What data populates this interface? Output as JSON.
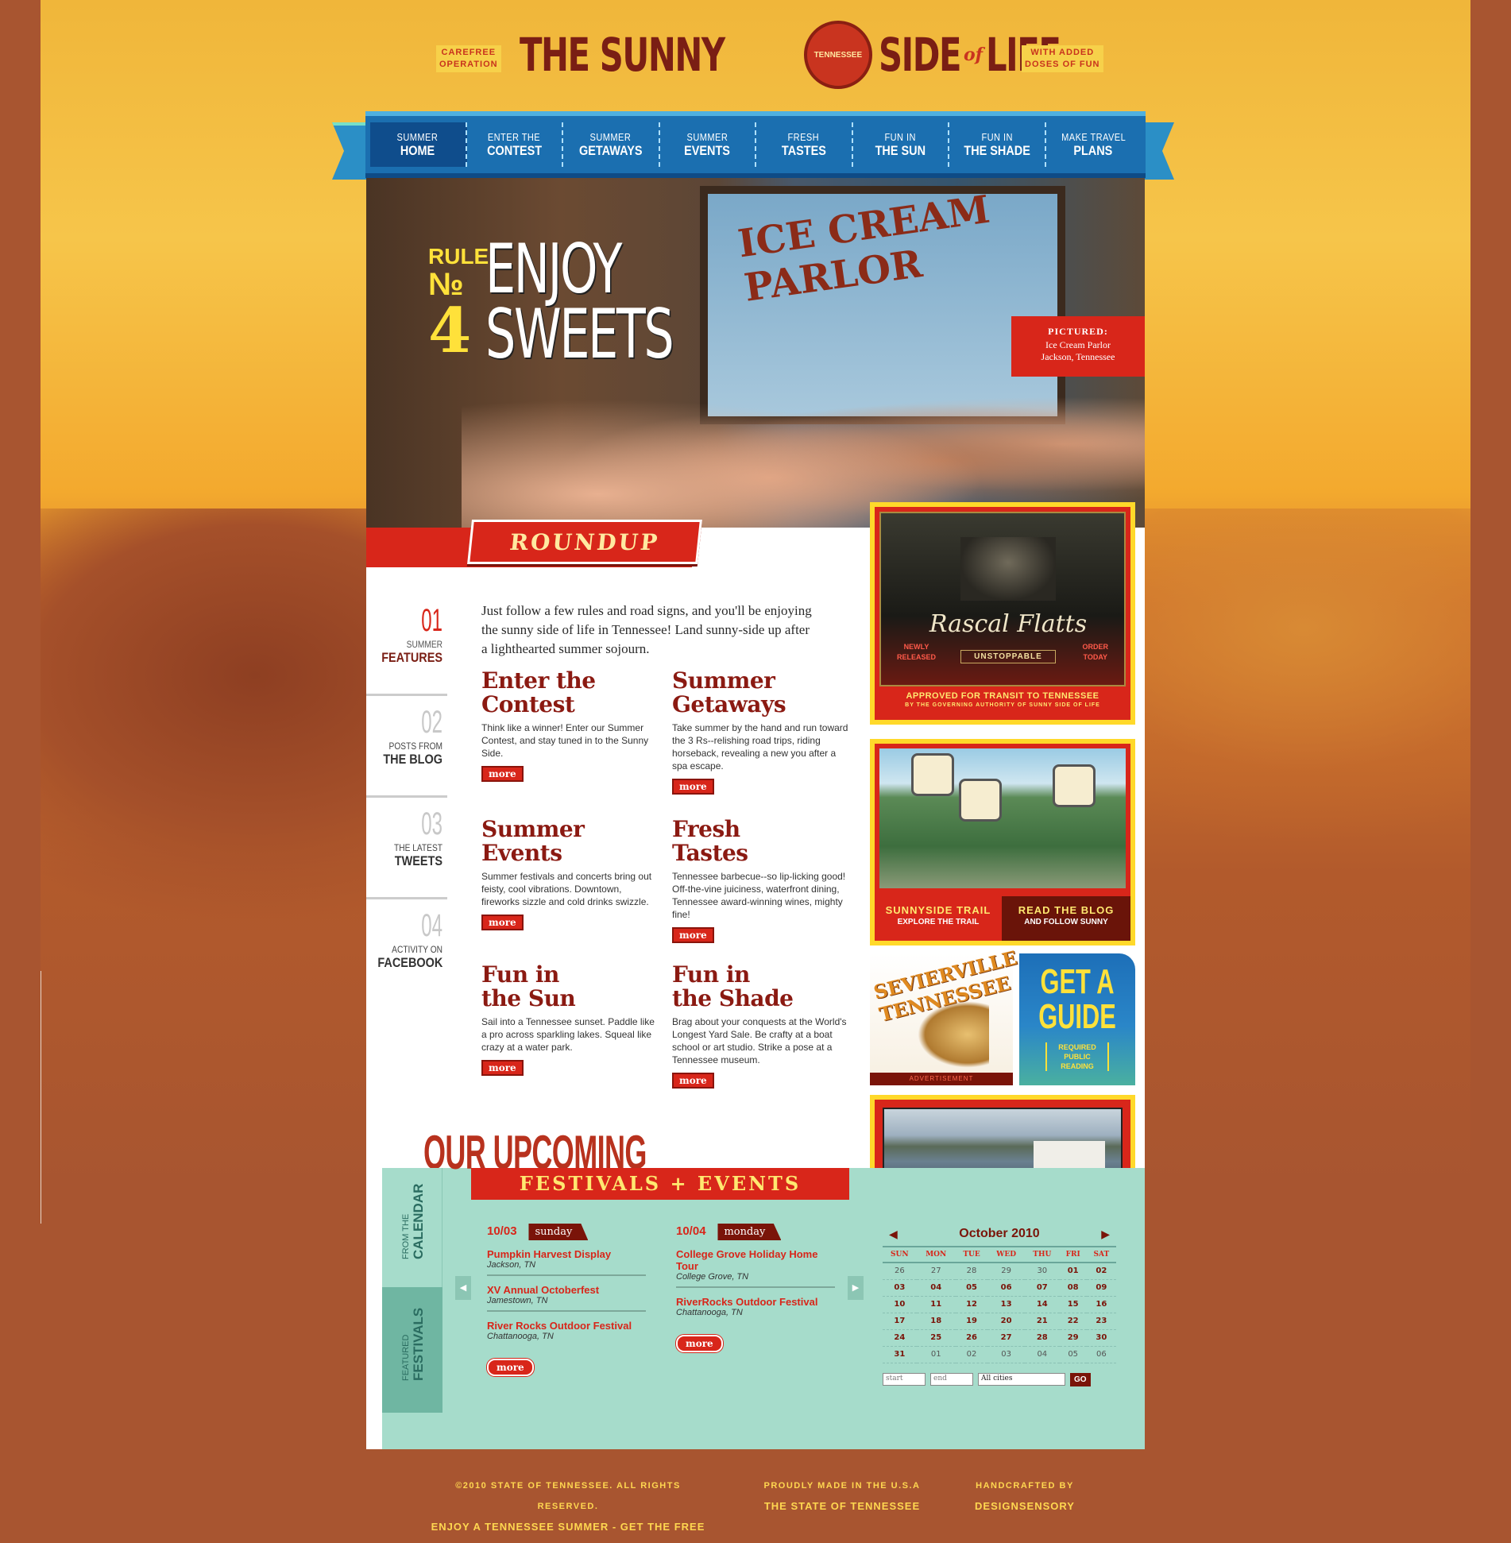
{
  "header": {
    "tag_left": [
      "CAREFREE",
      "OPERATION"
    ],
    "tag_right": [
      "WITH ADDED",
      "DOSES OF FUN"
    ],
    "logo_part1": "THE SUNNY",
    "logo_seal": "TENNESSEE",
    "logo_part2": "SIDE",
    "logo_of": "of",
    "logo_part3": "LIFE"
  },
  "nav": [
    {
      "l1": "SUMMER",
      "l2": "HOME",
      "active": true
    },
    {
      "l1": "ENTER THE",
      "l2": "CONTEST"
    },
    {
      "l1": "SUMMER",
      "l2": "GETAWAYS"
    },
    {
      "l1": "SUMMER",
      "l2": "EVENTS"
    },
    {
      "l1": "FRESH",
      "l2": "TASTES"
    },
    {
      "l1": "FUN IN",
      "l2": "THE SUN"
    },
    {
      "l1": "FUN IN",
      "l2": "THE SHADE"
    },
    {
      "l1": "MAKE TRAVEL",
      "l2": "PLANS"
    }
  ],
  "hero": {
    "rule_word": "RULE",
    "rule_no": "№",
    "rule_num": "4",
    "headline1": "ENJOY",
    "headline2": "SWEETS",
    "sign": "ICE CREAM PARLOR",
    "pictured_label": "PICTURED:",
    "pictured_line1": "Ice Cream Parlor",
    "pictured_line2": "Jackson, Tennessee"
  },
  "roundup_label": "ROUNDUP",
  "side_tabs": [
    {
      "num": "01",
      "t1": "SUMMER",
      "t2": "FEATURES",
      "active": true
    },
    {
      "num": "02",
      "t1": "POSTS FROM",
      "t2": "THE BLOG"
    },
    {
      "num": "03",
      "t1": "THE LATEST",
      "t2": "TWEETS"
    },
    {
      "num": "04",
      "t1": "ACTIVITY ON",
      "t2": "FACEBOOK"
    }
  ],
  "intro": "Just follow a few rules and road signs, and you'll be enjoying the sunny side of life in Tennessee! Land sunny-side up after a lighthearted summer sojourn.",
  "features": [
    {
      "title1": "Enter the",
      "title2": "Contest",
      "text": "Think like a winner! Enter our Summer Contest, and stay tuned in to the Sunny Side.",
      "more": "more"
    },
    {
      "title1": "Summer",
      "title2": "Getaways",
      "text": "Take summer by the hand and run toward the 3 Rs--relishing road trips, riding horseback, revealing a new you after a spa escape.",
      "more": "more"
    },
    {
      "title1": "Summer",
      "title2": "Events",
      "text": "Summer festivals and concerts bring out feisty, cool vibrations. Downtown, fireworks sizzle and cold drinks swizzle.",
      "more": "more"
    },
    {
      "title1": "Fresh",
      "title2": "Tastes",
      "text": "Tennessee barbecue--so lip-licking good! Off-the-vine juiciness, waterfront dining, Tennessee award-winning wines, mighty fine!",
      "more": "more"
    },
    {
      "title1": "Fun in",
      "title2": "the Sun",
      "text": "Sail into a Tennessee sunset. Paddle like a pro across sparkling lakes. Squeal like crazy at a water park.",
      "more": "more"
    },
    {
      "title1": "Fun in",
      "title2": "the Shade",
      "text": "Brag about your conquests at the World's Longest Yard Sale. Be crafty at a boat school or art studio. Strike a pose at a Tennessee museum.",
      "more": "more"
    }
  ],
  "promo_band": {
    "title": "Rascal Flatts",
    "subtitle": "UNSTOPPABLE",
    "left_note": [
      "NEWLY",
      "RELEASED"
    ],
    "right_note": [
      "ORDER",
      "TODAY"
    ],
    "footer": "APPROVED FOR TRANSIT TO TENNESSEE",
    "footer_small": "BY THE GOVERNING AUTHORITY OF SUNNY SIDE OF LIFE"
  },
  "promo_trail": {
    "b1_title": "SUNNYSIDE TRAIL",
    "b1_sub": "EXPLORE THE TRAIL",
    "b2_title": "READ THE BLOG",
    "b2_sub": "AND FOLLOW SUNNY"
  },
  "ad": {
    "brand": "SEVIERVILLE TENNESSEE",
    "label": "ADVERTISEMENT"
  },
  "guide": {
    "title1": "GET A",
    "title2": "GUIDE",
    "sub1": "REQUIRED",
    "sub2": "PUBLIC",
    "sub3": "READING"
  },
  "festivals": {
    "title1": "OUR UPCOMING",
    "title2": "FESTIVALS + EVENTS",
    "tab_calendar_small": "FROM THE",
    "tab_calendar_big": "CALENDAR",
    "tab_featured_small": "FEATURED",
    "tab_featured_big": "FESTIVALS",
    "days": [
      {
        "date": "10/03",
        "name": "sunday",
        "events": [
          {
            "name": "Pumpkin Harvest Display",
            "loc": "Jackson, TN"
          },
          {
            "name": "XV Annual Octoberfest",
            "loc": "Jamestown, TN"
          },
          {
            "name": "River Rocks Outdoor Festival",
            "loc": "Chattanooga, TN"
          }
        ],
        "more": "more"
      },
      {
        "date": "10/04",
        "name": "monday",
        "events": [
          {
            "name": "College Grove Holiday Home Tour",
            "loc": "College Grove, TN"
          },
          {
            "name": "RiverRocks Outdoor Festival",
            "loc": "Chattanooga, TN"
          }
        ],
        "more": "more"
      }
    ]
  },
  "calendar": {
    "month": "October 2010",
    "prev": "◀",
    "next": "▶",
    "weekdays": [
      "SUN",
      "MON",
      "TUE",
      "WED",
      "THU",
      "FRI",
      "SAT"
    ],
    "weeks": [
      [
        "26",
        "27",
        "28",
        "29",
        "30",
        "01",
        "02"
      ],
      [
        "03",
        "04",
        "05",
        "06",
        "07",
        "08",
        "09"
      ],
      [
        "10",
        "11",
        "12",
        "13",
        "14",
        "15",
        "16"
      ],
      [
        "17",
        "18",
        "19",
        "20",
        "21",
        "22",
        "23"
      ],
      [
        "24",
        "25",
        "26",
        "27",
        "28",
        "29",
        "30"
      ],
      [
        "31",
        "01",
        "02",
        "03",
        "04",
        "05",
        "06"
      ]
    ],
    "start_placeholder": "start",
    "end_placeholder": "end",
    "city_select": "All cities",
    "go": "GO"
  },
  "footer": {
    "c1a": "©2010 STATE OF TENNESSEE. ALL RIGHTS RESERVED.",
    "c1b": "ENJOY A TENNESSEE SUMMER - GET THE FREE GUIDE",
    "c2a": "PROUDLY MADE IN THE U.S.A",
    "c2b": "THE STATE OF TENNESSEE",
    "c3a": "HANDCRAFTED BY",
    "c3b": "DESIGNSENSORY"
  }
}
